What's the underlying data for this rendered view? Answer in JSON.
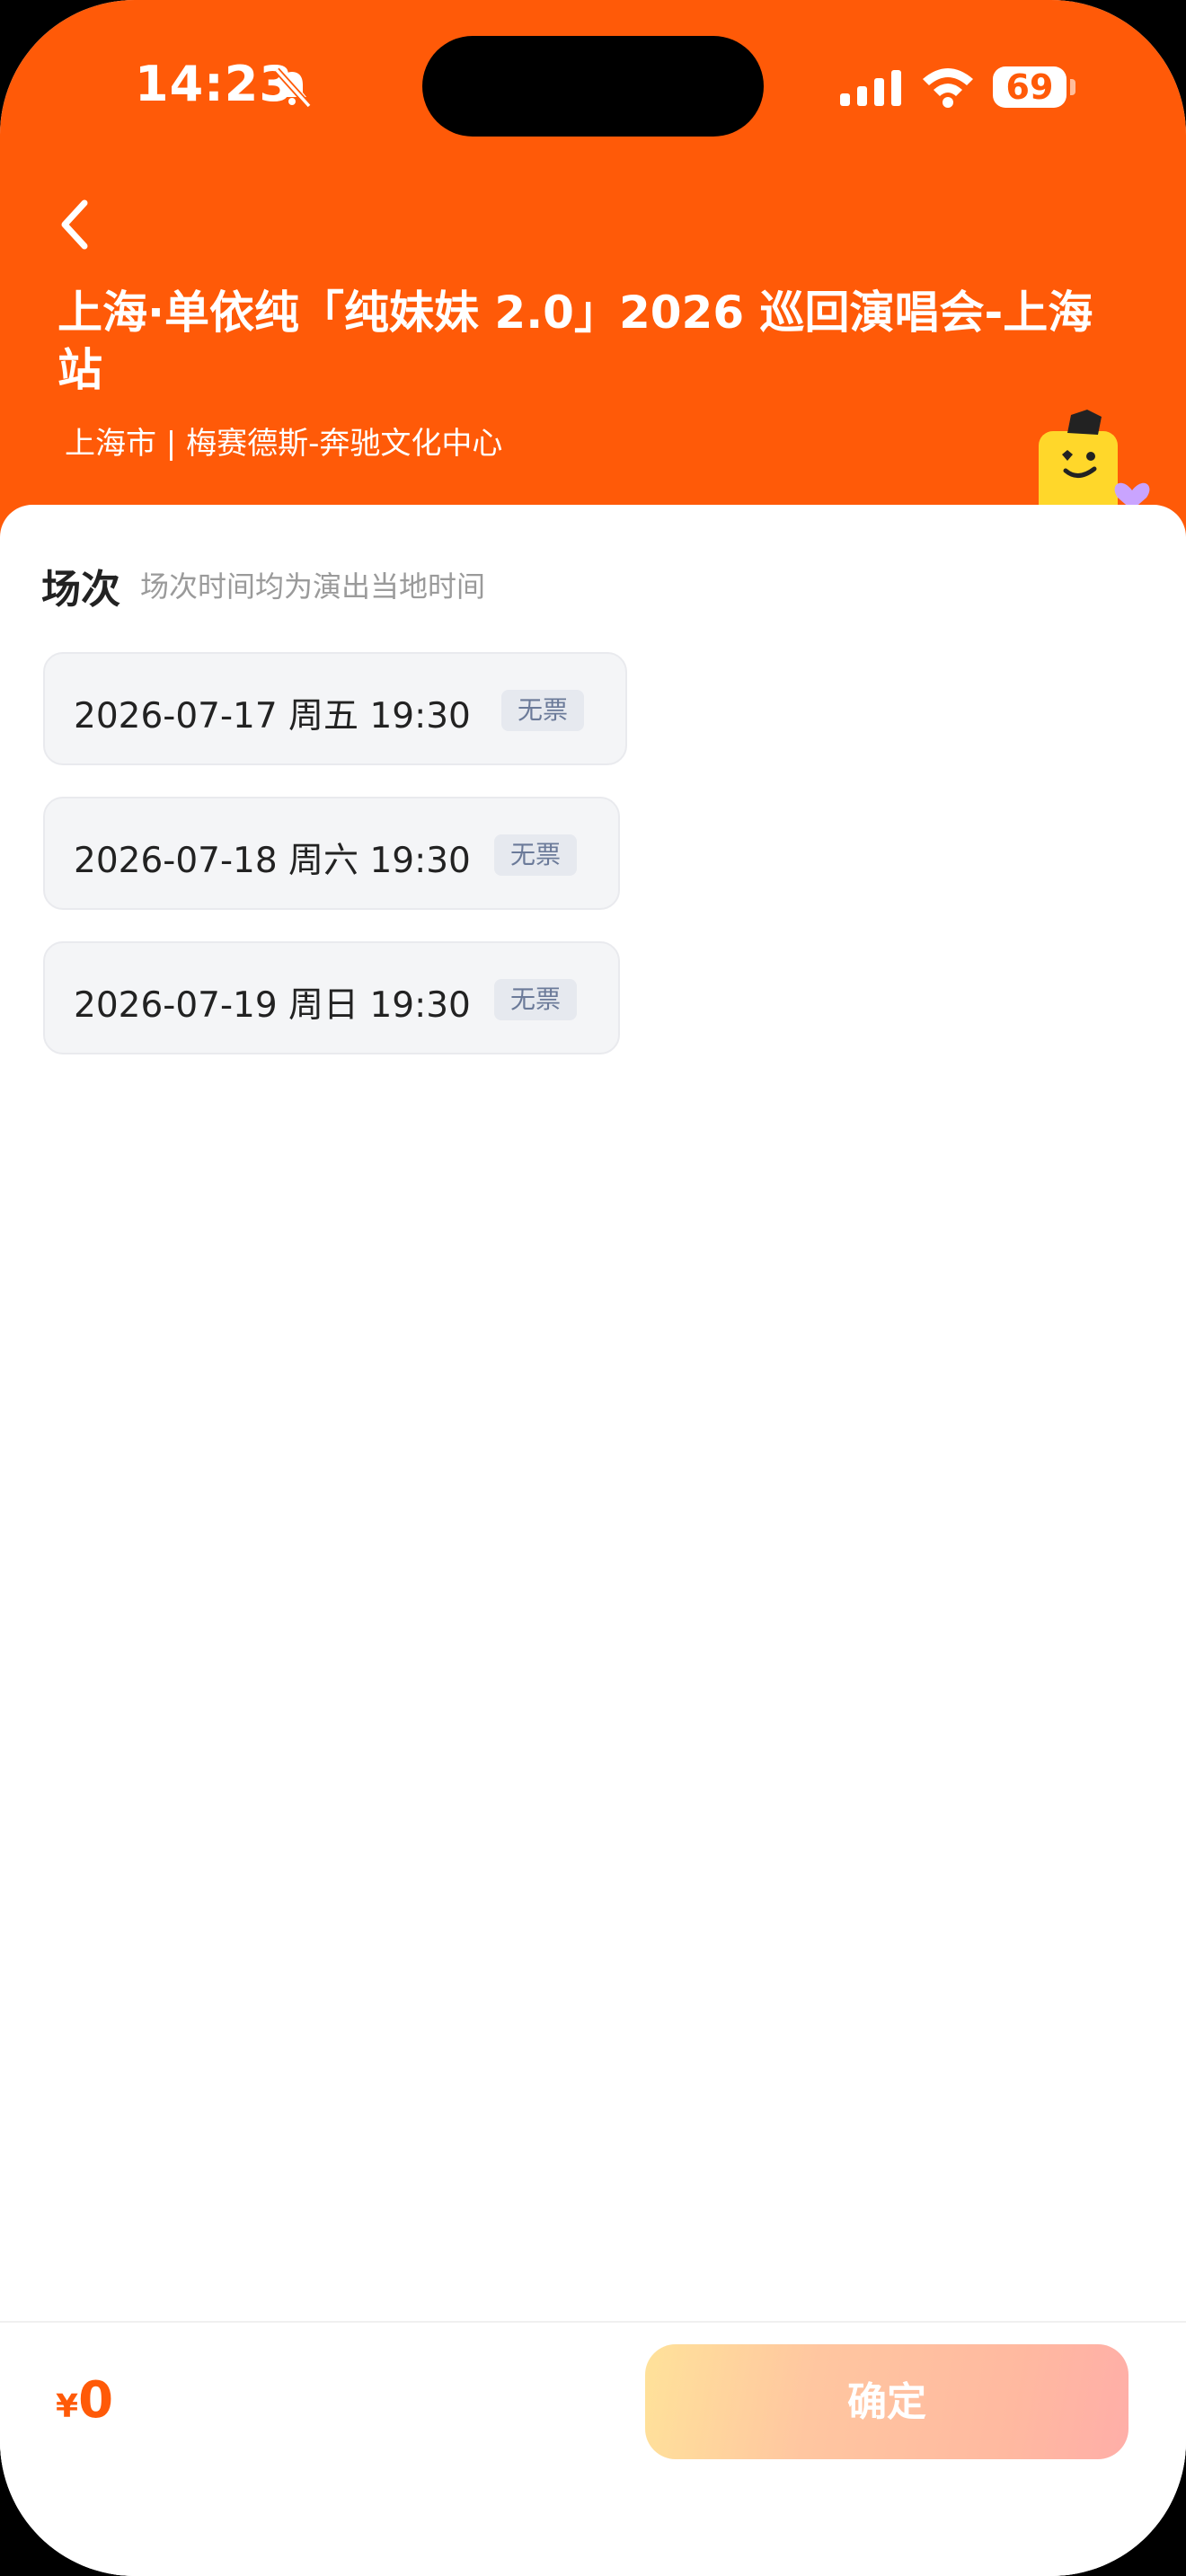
{
  "status_bar": {
    "time": "14:23",
    "battery": "69"
  },
  "header": {
    "title": "上海·单依纯「纯妹妹 2.0」2026 巡回演唱会-上海站",
    "subtitle": "上海市 | 梅赛德斯-奔驰文化中心"
  },
  "sessions_section": {
    "title": "场次",
    "hint": "场次时间均为演出当地时间",
    "items": [
      {
        "label": "2026-07-17  周五 19:30",
        "tag": "无票"
      },
      {
        "label": "2026-07-18 周六 19:30",
        "tag": "无票"
      },
      {
        "label": "2026-07-19 周日 19:30",
        "tag": "无票"
      }
    ]
  },
  "footer": {
    "currency": "¥",
    "price": "0",
    "confirm_label": "确定"
  },
  "colors": {
    "brand": "#ff5a08",
    "tag_text": "#6b7a99"
  }
}
